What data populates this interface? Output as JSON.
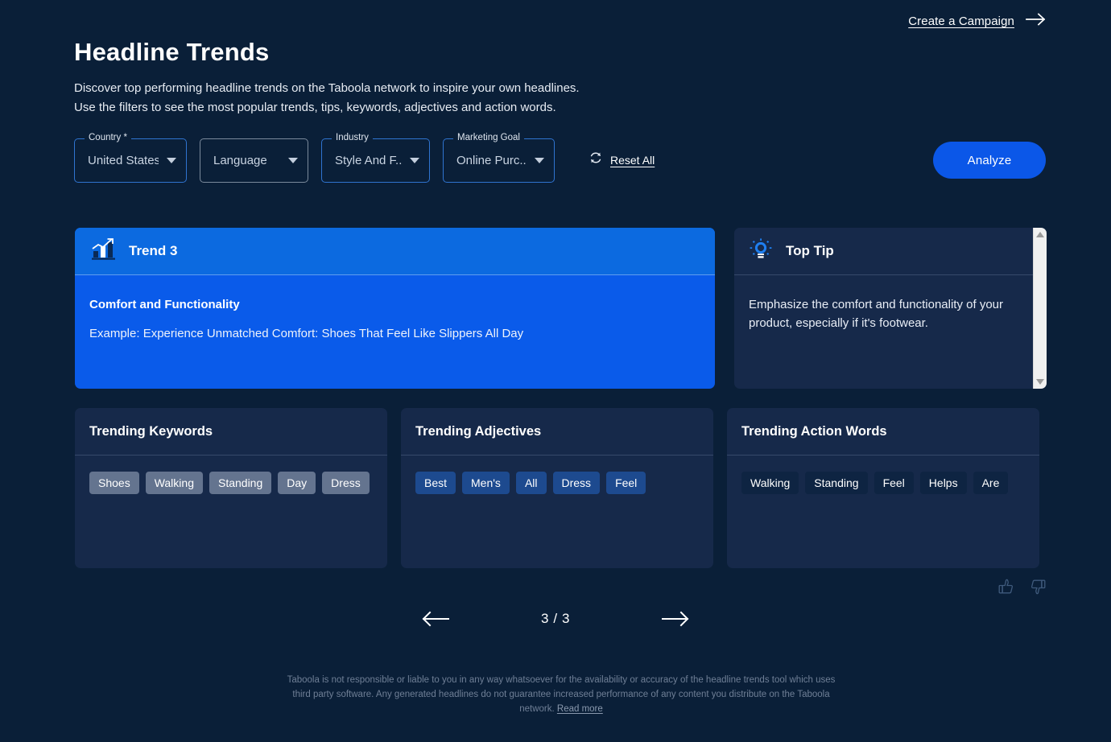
{
  "header": {
    "title": "Headline Trends",
    "subtitle_line1": "Discover top performing headline trends on the Taboola network to inspire your own headlines.",
    "subtitle_line2": "Use the filters to see the most popular trends, tips, keywords, adjectives and action words."
  },
  "top_link": {
    "label": "Create a Campaign",
    "icon": "arrow-right-icon"
  },
  "filters": {
    "country": {
      "label": "Country *",
      "value": "United States",
      "active": true
    },
    "language": {
      "label": "Language",
      "value": "Language",
      "active": false
    },
    "industry": {
      "label": "Industry",
      "value": "Style And F...",
      "active": true
    },
    "marketing_goal": {
      "label": "Marketing Goal",
      "value": "Online Purc...",
      "active": true
    },
    "reset": {
      "label": "Reset All",
      "icon": "refresh-icon"
    },
    "analyze_button": "Analyze"
  },
  "trend": {
    "icon": "bar-chart-trending-up-icon",
    "header_title": "Trend 3",
    "name": "Comfort and Functionality",
    "example": "Example: Experience Unmatched Comfort: Shoes That Feel Like Slippers All Day"
  },
  "top_tip": {
    "icon": "lightbulb-icon",
    "title": "Top Tip",
    "text": "Emphasize the comfort and functionality of your product, especially if it's footwear."
  },
  "panels": [
    {
      "title": "Trending Keywords",
      "chip_style": "keyword",
      "chips": [
        "Shoes",
        "Walking",
        "Standing",
        "Day",
        "Dress"
      ]
    },
    {
      "title": "Trending Adjectives",
      "chip_style": "adjective",
      "chips": [
        "Best",
        "Men's",
        "All",
        "Dress",
        "Feel"
      ]
    },
    {
      "title": "Trending Action Words",
      "chip_style": "action",
      "chips": [
        "Walking",
        "Standing",
        "Feel",
        "Helps",
        "Are"
      ]
    }
  ],
  "feedback": {
    "thumbs_up": "thumbs-up-icon",
    "thumbs_down": "thumbs-down-icon"
  },
  "pagination": {
    "prev_icon": "arrow-left-icon",
    "next_icon": "arrow-right-icon",
    "count": "3 / 3"
  },
  "footer": {
    "text": "Taboola is not responsible or liable to you in any way whatsoever for the availability or accuracy of the headline trends tool which uses third party software. Any generated headlines do not guarantee increased performance of any content you distribute on the Taboola network. ",
    "read_more": "Read more"
  },
  "colors": {
    "page_background": "#0a1f38",
    "panel_background": "#16294a",
    "accent_blue": "#0b57e8",
    "trend_card": "#0a5bea",
    "trend_header": "#0c6ae0",
    "chip_keyword": "#64748f",
    "chip_adjective": "#1d4a8f",
    "chip_action": "#0e2442"
  }
}
